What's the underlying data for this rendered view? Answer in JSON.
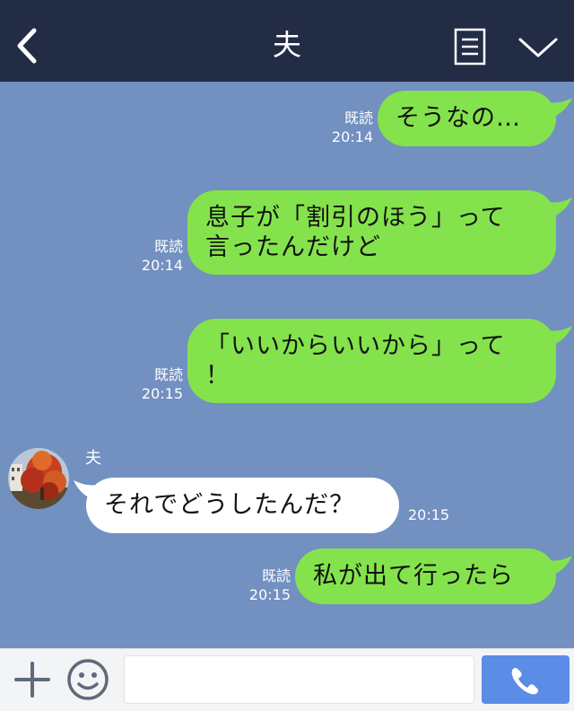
{
  "header": {
    "title": "夫"
  },
  "messages": [
    {
      "from": "me",
      "read_label": "既読",
      "time": "20:14",
      "lines": [
        "そうなの…"
      ]
    },
    {
      "from": "me",
      "read_label": "既読",
      "time": "20:14",
      "lines": [
        "息子が「割引のほう」って",
        "言ったんだけど"
      ]
    },
    {
      "from": "me",
      "read_label": "既読",
      "time": "20:15",
      "lines": [
        "「いいからいいから」って",
        "！"
      ]
    },
    {
      "from": "them",
      "sender": "夫",
      "time": "20:15",
      "lines": [
        "それでどうしたんだ？"
      ]
    },
    {
      "from": "me",
      "read_label": "既読",
      "time": "20:15",
      "lines": [
        "私が出て行ったら"
      ]
    }
  ],
  "footer": {
    "input_value": "",
    "input_placeholder": ""
  },
  "colors": {
    "header_bg": "#232c45",
    "chat_bg": "#7290c0",
    "my_bubble": "#84e34c",
    "their_bubble": "#ffffff",
    "call_button": "#5b8ce6"
  },
  "icons": {
    "back": "chevron-left-icon",
    "menu": "list-menu-icon",
    "collapse": "chevron-down-icon",
    "plus": "plus-icon",
    "emoji": "smiley-icon",
    "call": "phone-icon"
  }
}
